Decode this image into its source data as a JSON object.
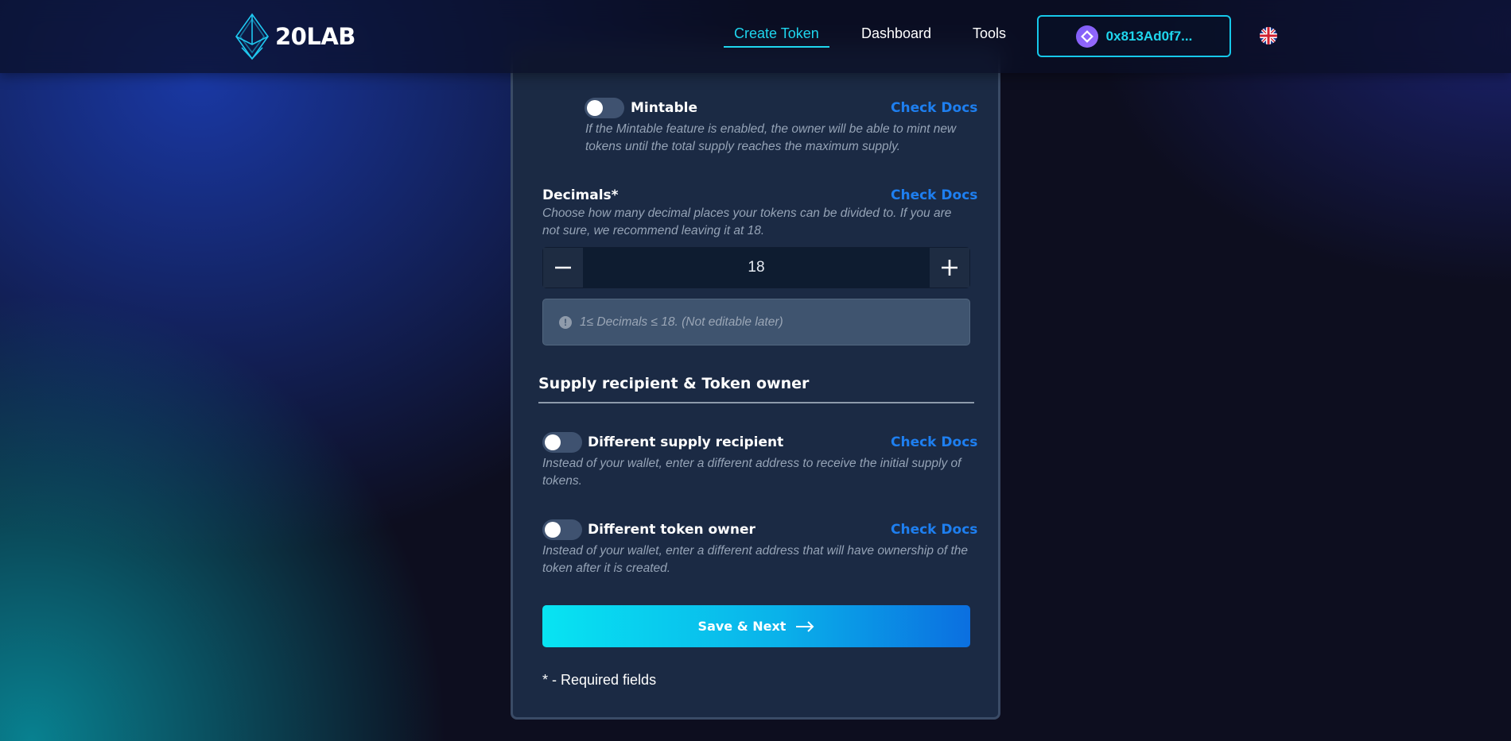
{
  "header": {
    "logo_text": "20LAB",
    "nav": [
      {
        "label": "Create Token"
      },
      {
        "label": "Dashboard"
      },
      {
        "label": "Tools"
      }
    ],
    "wallet_address": "0x813Ad0f7...",
    "language_flag": "uk-flag-icon"
  },
  "form": {
    "mintable": {
      "label": "Mintable",
      "docs": "Check Docs",
      "description": "If the Mintable feature is enabled, the owner will be able to mint new tokens until the total supply reaches the maximum supply.",
      "enabled": false
    },
    "decimals": {
      "label": "Decimals*",
      "docs": "Check Docs",
      "description": "Choose how many decimal places your tokens can be divided to. If you are not sure, we recommend leaving it at 18.",
      "value": "18",
      "minus": "−",
      "plus": "+",
      "hint": "1≤ Decimals ≤ 18. (Not editable later)"
    },
    "section_title": "Supply recipient & Token owner",
    "supply_recipient": {
      "label": "Different supply recipient",
      "docs": "Check Docs",
      "description": "Instead of your wallet, enter a different address to receive the initial supply of tokens.",
      "enabled": false
    },
    "token_owner": {
      "label": "Different token owner",
      "docs": "Check Docs",
      "description": "Instead of your wallet, enter a different address that will have ownership of the token after it is created.",
      "enabled": false
    },
    "save_button": "Save & Next",
    "required_note": "* - Required fields"
  },
  "colors": {
    "accent": "#1fd6ee",
    "docs_link": "#1e7ff0",
    "card_bg": "#1b2a44",
    "button_gradient_start": "#08e4f2",
    "button_gradient_end": "#0b6fe0"
  }
}
